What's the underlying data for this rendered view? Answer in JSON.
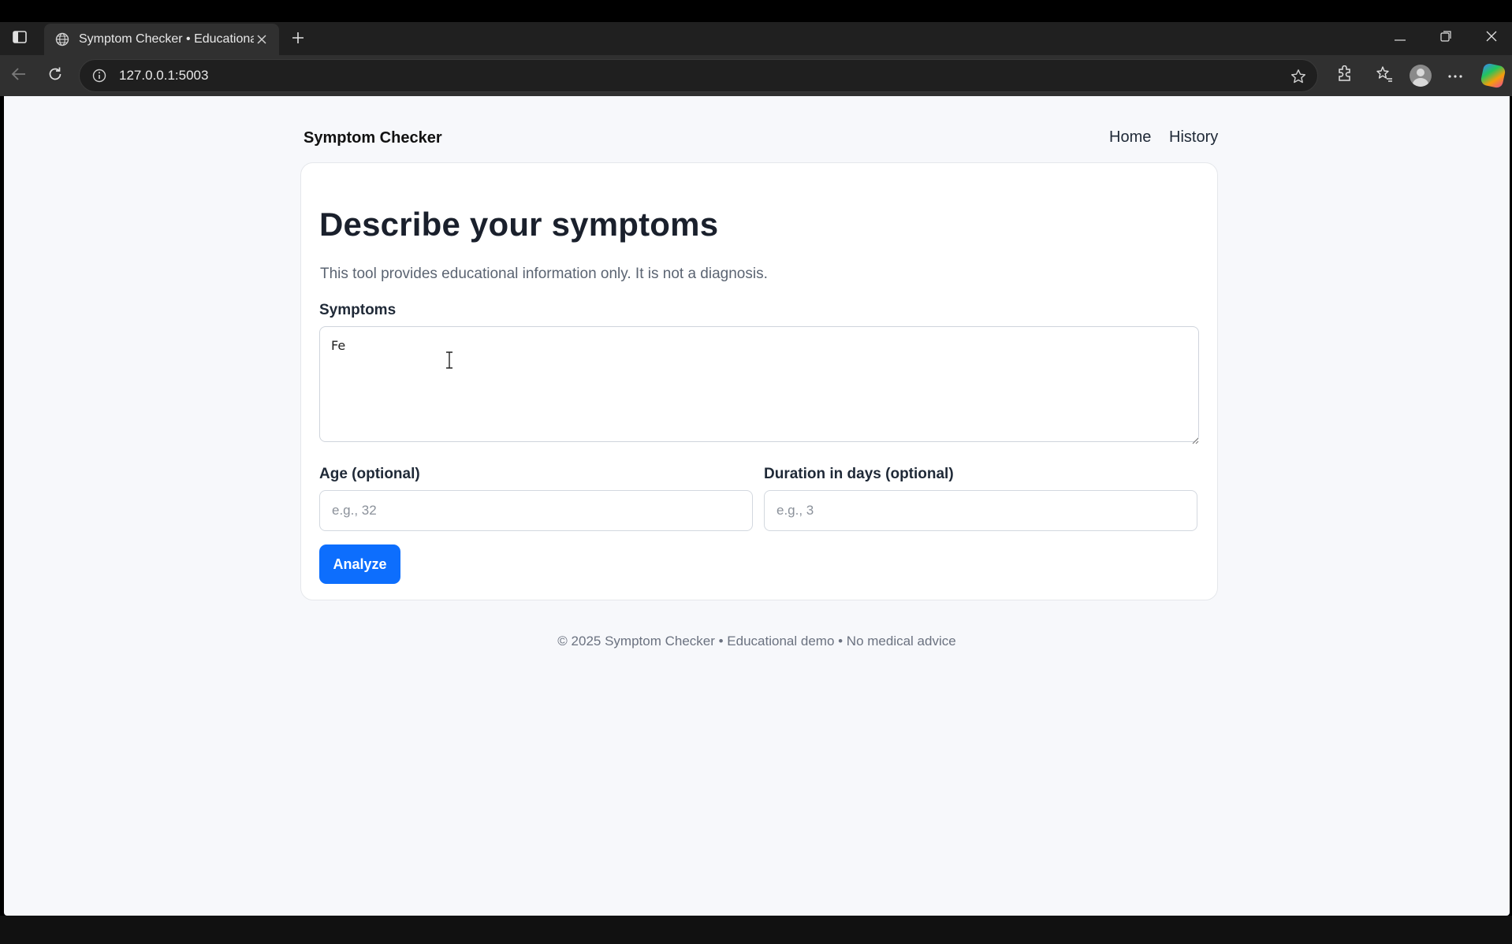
{
  "browser": {
    "tab_title": "Symptom Checker • Educational",
    "url": "127.0.0.1:5003",
    "icons": [
      "tab-panel-icon",
      "globe-icon",
      "close-icon",
      "plus-icon",
      "minimize-icon",
      "restore-icon",
      "close-window-icon",
      "back-icon",
      "reload-icon",
      "info-icon",
      "star-icon",
      "extensions-icon",
      "favorites-icon",
      "profile-icon",
      "more-icon",
      "copilot-icon"
    ]
  },
  "header": {
    "brand": "Symptom Checker",
    "nav": [
      {
        "label": "Home"
      },
      {
        "label": "History"
      }
    ]
  },
  "form": {
    "title": "Describe your symptoms",
    "intro": "This tool provides educational information only. It is not a diagnosis.",
    "symptoms_label": "Symptoms",
    "symptoms_value": "Fe",
    "age_label": "Age (optional)",
    "age_placeholder": "e.g., 32",
    "duration_label": "Duration in days (optional)",
    "duration_placeholder": "e.g., 3",
    "submit_label": "Analyze"
  },
  "footer": {
    "text": "© 2025 Symptom Checker • Educational demo • No medical advice"
  },
  "colors": {
    "accent": "#0d6efd",
    "page_bg": "#f7f8fb",
    "browser_chrome": "#303030"
  }
}
